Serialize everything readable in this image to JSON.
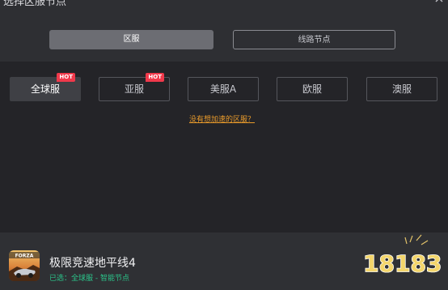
{
  "title": "选择区服节点",
  "tabs": {
    "region": "区服",
    "route": "线路节点"
  },
  "regions": [
    {
      "label": "全球服",
      "hot": "HOT"
    },
    {
      "label": "亚服",
      "hot": "HOT"
    },
    {
      "label": "美服A",
      "hot": ""
    },
    {
      "label": "欧服",
      "hot": ""
    },
    {
      "label": "澳服",
      "hot": ""
    }
  ],
  "help_link": "没有想加速的区服？",
  "game": {
    "name": "极限竞速地平线4",
    "status": "已选：全球服 - 智能节点",
    "icon_text": "FORZA"
  },
  "watermark": "18183",
  "colors": {
    "accent": "#e89a2b",
    "hot_badge": "#f0394b",
    "status_green": "#2bc48a"
  }
}
